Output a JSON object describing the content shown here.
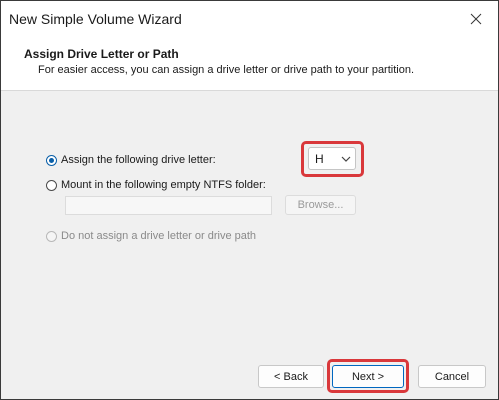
{
  "window": {
    "title": "New Simple Volume Wizard"
  },
  "header": {
    "title": "Assign Drive Letter or Path",
    "subtitle": "For easier access, you can assign a drive letter or drive path to your partition."
  },
  "options": {
    "assign_letter": {
      "label": "Assign the following drive letter:",
      "selected": true
    },
    "mount_folder": {
      "label": "Mount in the following empty NTFS folder:",
      "selected": false
    },
    "no_assign": {
      "label": "Do not assign a drive letter or drive path",
      "selected": false,
      "disabled": true
    }
  },
  "drive_letter": {
    "value": "H"
  },
  "mount_path": {
    "value": ""
  },
  "buttons": {
    "browse": "Browse...",
    "back": "< Back",
    "next": "Next >",
    "cancel": "Cancel"
  },
  "colors": {
    "highlight": "#d9383b",
    "accent": "#0a5fa8"
  }
}
